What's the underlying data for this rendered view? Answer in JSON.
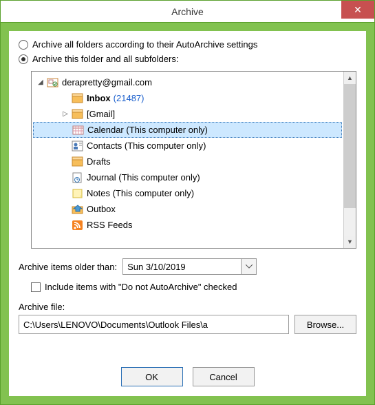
{
  "window": {
    "title": "Archive",
    "close": "✕"
  },
  "options": {
    "archive_all": "Archive all folders according to their AutoArchive settings",
    "archive_this": "Archive this folder and all subfolders:"
  },
  "tree": {
    "account": "derapretty@gmail.com",
    "items": [
      {
        "label": "Inbox",
        "count": "(21487)"
      },
      {
        "label": "[Gmail]"
      },
      {
        "label": "Calendar (This computer only)"
      },
      {
        "label": "Contacts (This computer only)"
      },
      {
        "label": "Drafts"
      },
      {
        "label": "Journal (This computer only)"
      },
      {
        "label": "Notes (This computer only)"
      },
      {
        "label": "Outbox"
      },
      {
        "label": "RSS Feeds"
      }
    ]
  },
  "older_than": {
    "label": "Archive items older than:",
    "value": "Sun 3/10/2019"
  },
  "include_checkbox": "Include items with \"Do not AutoArchive\" checked",
  "archive_file": {
    "label": "Archive file:",
    "value": "C:\\Users\\LENOVO\\Documents\\Outlook Files\\a",
    "browse": "Browse..."
  },
  "buttons": {
    "ok": "OK",
    "cancel": "Cancel"
  }
}
